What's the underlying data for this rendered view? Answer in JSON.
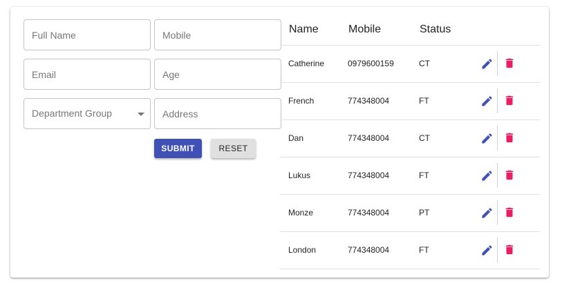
{
  "form": {
    "full_name_placeholder": "Full Name",
    "mobile_placeholder": "Mobile",
    "email_placeholder": "Email",
    "age_placeholder": "Age",
    "department_label": "Department Group",
    "address_placeholder": "Address",
    "submit_label": "SUBMIT",
    "reset_label": "RESET"
  },
  "table": {
    "headers": {
      "name": "Name",
      "mobile": "Mobile",
      "status": "Status"
    },
    "rows": [
      {
        "name": "Catherine",
        "mobile": "0979600159",
        "status": "CT"
      },
      {
        "name": "French",
        "mobile": "774348004",
        "status": "FT"
      },
      {
        "name": "Dan",
        "mobile": "774348004",
        "status": "CT"
      },
      {
        "name": "Lukus",
        "mobile": "774348004",
        "status": "FT"
      },
      {
        "name": "Monze",
        "mobile": "774348004",
        "status": "PT"
      },
      {
        "name": "London",
        "mobile": "774348004",
        "status": "FT"
      }
    ]
  },
  "icons": {
    "edit": "edit-icon",
    "delete": "delete-icon",
    "dropdown": "chevron-down-icon"
  },
  "colors": {
    "primary": "#3f51b5",
    "danger": "#e91e63",
    "reset_bg": "#e0e0e0"
  }
}
